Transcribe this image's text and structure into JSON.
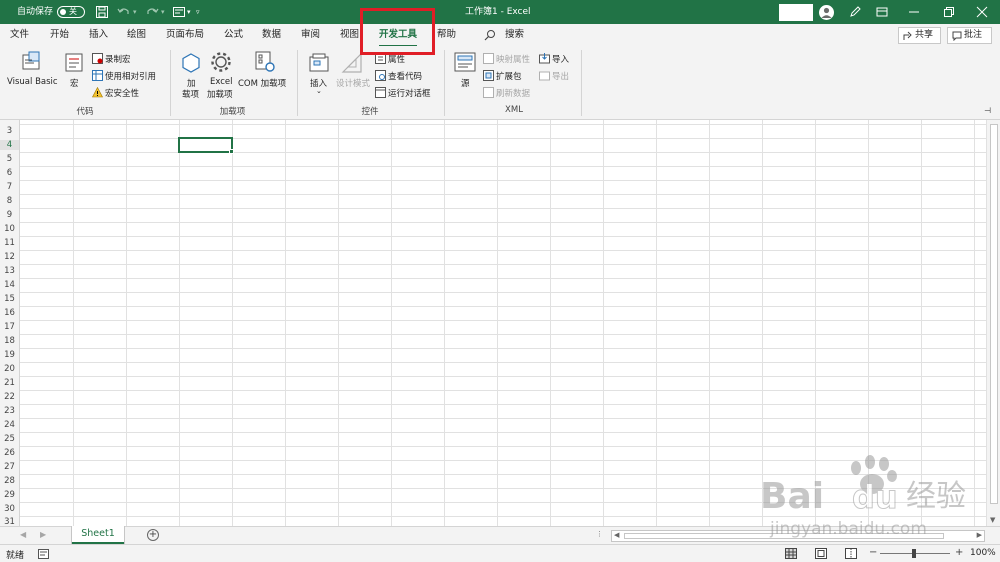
{
  "titlebar": {
    "autosave_label": "自动保存",
    "autosave_state": "关",
    "document_title": "工作簿1 - Excel"
  },
  "tabs": [
    {
      "label": "文件"
    },
    {
      "label": "开始"
    },
    {
      "label": "插入"
    },
    {
      "label": "绘图"
    },
    {
      "label": "页面布局"
    },
    {
      "label": "公式"
    },
    {
      "label": "数据"
    },
    {
      "label": "审阅"
    },
    {
      "label": "视图"
    },
    {
      "label": "开发工具"
    },
    {
      "label": "帮助"
    },
    {
      "label": "搜索"
    }
  ],
  "active_tab": "开发工具",
  "right_buttons": {
    "share": "共享",
    "comments": "批注"
  },
  "ribbon": {
    "code": {
      "group_label": "代码",
      "visual_basic": "Visual Basic",
      "macros": "宏",
      "record_macro": "录制宏",
      "relative_refs": "使用相对引用",
      "macro_security": "宏安全性"
    },
    "addins": {
      "group_label": "加载项",
      "addins_line1": "加",
      "addins_line2": "载项",
      "excel_addins_line1": "Excel",
      "excel_addins_line2": "加载项",
      "com_addins": "COM 加载项"
    },
    "controls": {
      "group_label": "控件",
      "insert": "插入",
      "design_mode": "设计模式",
      "properties": "属性",
      "view_code": "查看代码",
      "run_dialog": "运行对话框"
    },
    "xml": {
      "group_label": "XML",
      "source": "源",
      "map_properties": "映射属性",
      "expansion_packs": "扩展包",
      "refresh_data": "刷新数据",
      "import": "导入",
      "export": "导出"
    }
  },
  "grid": {
    "row_numbers": [
      "3",
      "4",
      "5",
      "6",
      "7",
      "8",
      "9",
      "10",
      "11",
      "12",
      "13",
      "14",
      "15",
      "16",
      "17",
      "18",
      "19",
      "20",
      "21",
      "22",
      "23",
      "24",
      "25",
      "26",
      "27",
      "28",
      "29",
      "30",
      "31"
    ],
    "active_row": "4"
  },
  "sheets": [
    {
      "label": "Sheet1"
    }
  ],
  "statusbar": {
    "status": "就绪",
    "zoom": "100%"
  },
  "watermark": {
    "brand": "Bai",
    "brand2": "du",
    "cn": "经验",
    "url": "jingyan.baidu.com"
  },
  "colors": {
    "excel_green": "#217346",
    "highlight_red": "#e01e26"
  }
}
